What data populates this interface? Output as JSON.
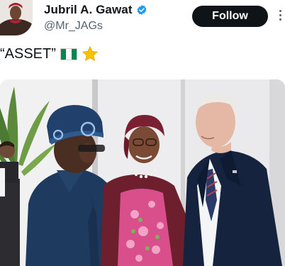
{
  "tweet": {
    "author": {
      "display_name": "Jubril A. Gawat",
      "handle": "@Mr_JAGs",
      "verified": true
    },
    "follow_label": "Follow",
    "text": "“ASSET”",
    "emojis": [
      "nigeria-flag-icon",
      "star-icon"
    ],
    "colors": {
      "text_primary": "#0f1419",
      "text_secondary": "#536471",
      "verified_blue": "#1d9bf0",
      "follow_bg": "#0f1419",
      "flag_green": "#008751",
      "star_gold": "#f7c300"
    }
  }
}
